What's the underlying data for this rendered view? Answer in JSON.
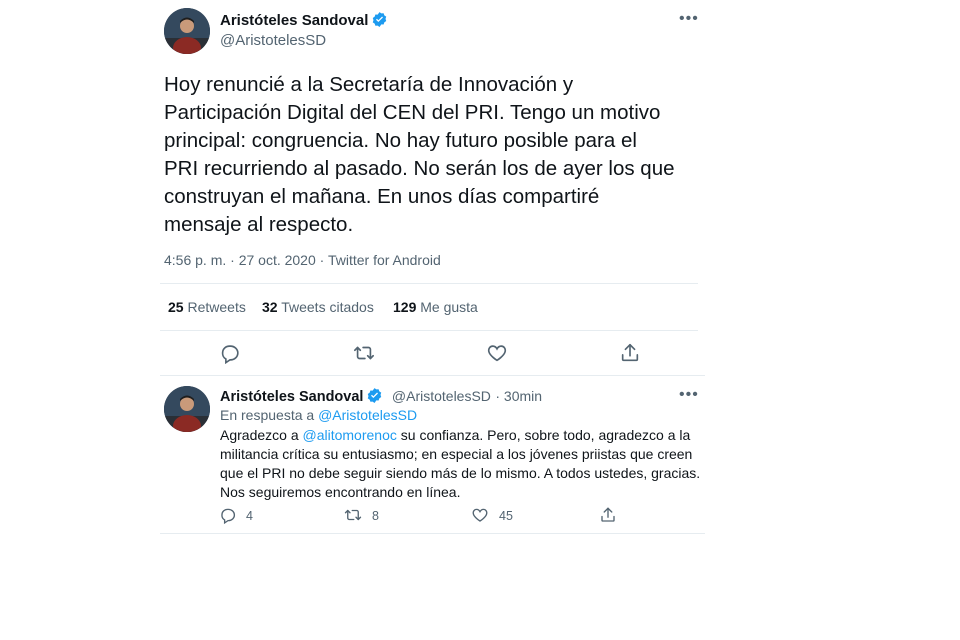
{
  "main_tweet": {
    "author_name": "Aristóteles Sandoval",
    "author_handle": "@AristotelesSD",
    "text_lines": [
      "Hoy renuncié a la Secretaría de Innovación y",
      "Participación Digital del CEN del PRI. Tengo un motivo",
      "principal: congruencia. No hay futuro posible para el",
      "PRI recurriendo al pasado. No serán los de ayer los que",
      "construyan el mañana. En unos días compartiré",
      "mensaje al respecto."
    ],
    "meta": "4:56 p. m. · 27 oct. 2020 · Twitter for Android",
    "stats": {
      "retweets_count": "25",
      "retweets_label": "Retweets",
      "quotes_count": "32",
      "quotes_label": "Tweets citados",
      "likes_count": "129",
      "likes_label": "Me gusta"
    },
    "icons": [
      "reply-icon",
      "retweet-icon",
      "like-icon",
      "share-icon"
    ]
  },
  "reply_tweet": {
    "author_name": "Aristóteles Sandoval",
    "author_handle": "@AristotelesSD",
    "time": "· 30min",
    "in_reply_prefix": "En respuesta a ",
    "in_reply_handle": "@AristotelesSD",
    "line1_before": "Agradezco a ",
    "line1_mention": "@alitomorenoc",
    "line1_after": " su confianza. Pero, sobre todo, agradezco a la",
    "line2": "militancia crítica su entusiasmo; en especial a los jóvenes priistas que creen",
    "line3": "que el PRI no debe seguir siendo más de lo mismo. A todos ustedes, gracias.",
    "line4": "Nos seguiremos encontrando en línea.",
    "counts": {
      "replies": "4",
      "retweets": "8",
      "likes": "45"
    }
  },
  "colors": {
    "accent": "#1d9bf0",
    "muted": "#536471",
    "divider": "#e6ecf0"
  }
}
